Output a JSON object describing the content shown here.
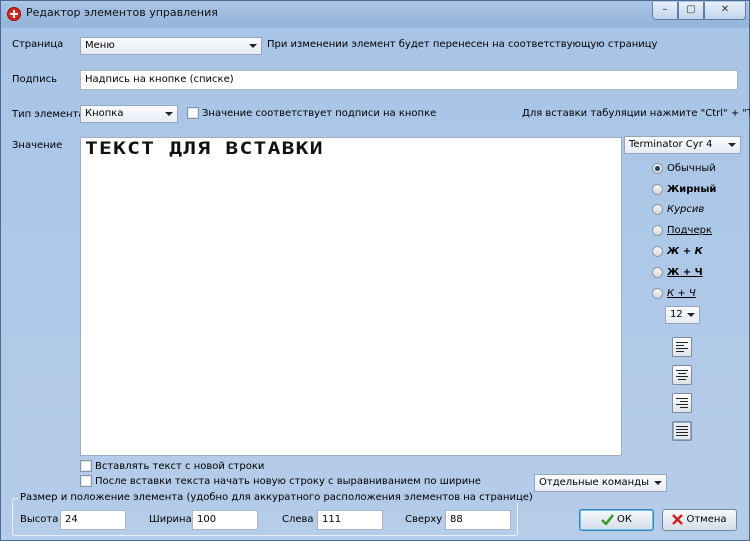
{
  "window": {
    "title": "Редактор элементов управления",
    "controls": {
      "minimize": "–",
      "maximize": "▢",
      "close": "✕"
    }
  },
  "page": {
    "label": "Страница",
    "value": "Меню",
    "hint": "При изменении элемент будет перенесен на соответствующую страницу"
  },
  "caption": {
    "label": "Подпись",
    "value": "Надпись на кнопке (списке)"
  },
  "element_type": {
    "label": "Тип элемента",
    "value": "Кнопка",
    "match_caption_label": "Значение соответствует подписи на кнопке",
    "match_caption_checked": false,
    "tab_hint": "Для вставки табуляции нажмите \"Ctrl\" + \"Tab\""
  },
  "value": {
    "label": "Значение",
    "text": "ТЕКСТ ДЛЯ ВСТАВКИ"
  },
  "font": {
    "family": "Terminator Cyr 4",
    "styles": [
      {
        "label": "Обычный",
        "selected": true
      },
      {
        "label": "Жирный",
        "selected": false
      },
      {
        "label": "Курсив",
        "selected": false
      },
      {
        "label": "Подчерк",
        "selected": false
      },
      {
        "label": "Ж + К",
        "selected": false
      },
      {
        "label": "Ж + Ч",
        "selected": false
      },
      {
        "label": "К + Ч",
        "selected": false
      }
    ],
    "size": "12",
    "alignments": [
      "align-left",
      "align-center",
      "align-right",
      "align-justify"
    ],
    "active_alignment": "align-justify"
  },
  "options": {
    "new_line_label": "Вставлять текст с новой строки",
    "new_line_checked": false,
    "justify_after_label": "После вставки текста начать новую строку с выравниванием по ширине",
    "justify_after_checked": false,
    "commands_value": "Отдельные команды"
  },
  "geometry_group": {
    "title": "Размер и положение элемента (удобно для аккуратного расположения элементов на странице)",
    "height_label": "Высота",
    "height_value": "24",
    "width_label": "Ширина",
    "width_value": "100",
    "left_label": "Слева",
    "left_value": "111",
    "top_label": "Сверху",
    "top_value": "88"
  },
  "buttons": {
    "ok": "ОК",
    "cancel": "Отмена"
  },
  "colors": {
    "window_bg": "#b6cde9",
    "ok_icon": "#2f9a2a",
    "cancel_icon": "#d02020"
  }
}
